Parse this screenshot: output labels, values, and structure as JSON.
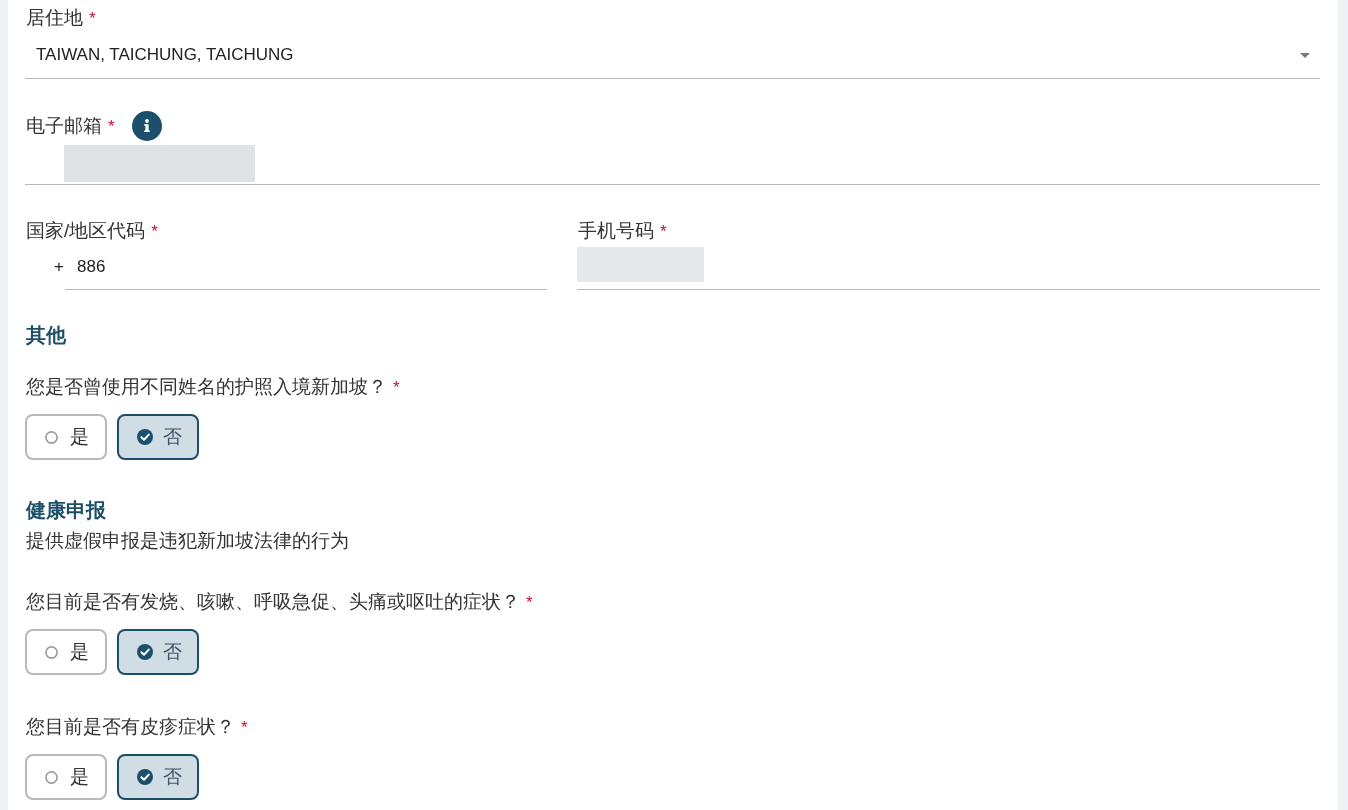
{
  "fields": [
    {
      "kind": "select",
      "label": "居住地",
      "required_mark": "*",
      "value": "TAIWAN, TAICHUNG, TAICHUNG"
    },
    {
      "kind": "text",
      "label": "电子邮箱",
      "required_mark": "*",
      "info_button": true,
      "redacted": true
    }
  ],
  "phone": {
    "country_code": {
      "label": "国家/地区代码",
      "required_mark": "*",
      "prefix": "+",
      "value": "886"
    },
    "number": {
      "label": "手机号码",
      "required_mark": "*",
      "redacted": true
    }
  },
  "sections": [
    {
      "title": "其他",
      "questions": [
        {
          "text": "您是否曾使用不同姓名的护照入境新加坡？",
          "required_mark": "*",
          "options": [
            {
              "label": "是",
              "selected": false
            },
            {
              "label": "否",
              "selected": true
            }
          ]
        }
      ]
    },
    {
      "title": "健康申报",
      "note": "提供虚假申报是违犯新加坡法律的行为",
      "questions": [
        {
          "text": "您目前是否有发烧、咳嗽、呼吸急促、头痛或呕吐的症状？",
          "required_mark": "*",
          "options": [
            {
              "label": "是",
              "selected": false
            },
            {
              "label": "否",
              "selected": true
            }
          ]
        },
        {
          "text": "您目前是否有皮疹症状？",
          "required_mark": "*",
          "options": [
            {
              "label": "是",
              "selected": false
            },
            {
              "label": "否",
              "selected": true
            }
          ]
        }
      ]
    }
  ]
}
